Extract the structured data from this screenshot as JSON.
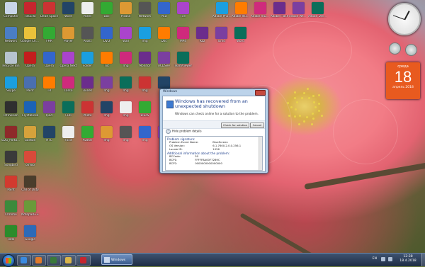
{
  "icons_col1": [
    {
      "label": "Computer",
      "color": "#c9d6e8"
    },
    {
      "label": "Network",
      "color": "#4a7ec4"
    },
    {
      "label": "Recycle Bin",
      "color": "#b7c4cf"
    },
    {
      "label": "Skype",
      "color": "#1a9fe0"
    },
    {
      "label": "InfoVision",
      "color": "#2f2f2f"
    },
    {
      "label": "SDG_Portable",
      "color": "#8e2a2a"
    },
    {
      "label": "Songbird",
      "color": "#3a3a3a"
    },
    {
      "label": "Paint",
      "color": "#d23a2f"
    },
    {
      "label": "Chrome",
      "color": "#3c8a3c"
    },
    {
      "label": "Total",
      "color": "#2b8c2b"
    }
  ],
  "icons_col2": [
    {
      "label": "FileZilla",
      "color": "#c6262e"
    },
    {
      "label": "Google Chrome",
      "color": "#e8c23a"
    },
    {
      "label": "Opera",
      "color": "#c31d1d"
    },
    {
      "label": "Paint",
      "color": "#4a6fb0"
    },
    {
      "label": "CrystalDisk",
      "color": "#1b63b6"
    },
    {
      "label": "Gadwin",
      "color": "#d6a23b"
    },
    {
      "label": "ooVoo",
      "color": "#d84a3a"
    },
    {
      "label": "Call of Duty",
      "color": "#4a3d2c"
    },
    {
      "label": "Notepad++",
      "color": "#6a9a3a"
    },
    {
      "label": "Google",
      "color": "#2d6ab8"
    }
  ],
  "desktop_icons_rows": [
    [
      "Dead Space",
      "Word",
      "Panel",
      "Doc",
      "Picasa",
      "Network",
      "PSD",
      "File",
      "Adobe Photoshop",
      "Adobe Illustrator",
      "Adobe InDesign",
      "Adobe Flash",
      "Adobe After Effects",
      "Adobe Dreamweaver"
    ],
    [
      "FHR",
      "Player",
      "Avast",
      "DVD",
      "Wall",
      "Img",
      "Doc",
      "MP4",
      "Raz",
      "Tcmd",
      "Word"
    ],
    [
      "Opera",
      "Opera Next",
      "Folder",
      "Txt",
      "Img",
      "Monitor",
      "ACDSee",
      "TeamViewer"
    ],
    [
      "TR",
      "Lasso",
      "iTunes",
      "Img",
      "Img",
      "Img",
      "Mk"
    ],
    [
      "Ipad",
      "FHR",
      "Photo",
      "Img",
      "Img",
      "BlueS"
    ],
    [
      "HTC",
      "Foxit",
      "Avatar",
      "Img",
      "Img",
      "Img",
      "Img"
    ]
  ],
  "gadgets": {
    "calendar": {
      "weekday": "среда",
      "day": "18",
      "month_year": "апрель 2018"
    }
  },
  "dialog": {
    "title": "Windows",
    "heading": "Windows has recovered from an unexpected shutdown",
    "subtext": "Windows can check online for a solution to the problem.",
    "check_button": "Check for solution",
    "cancel_button": "Cancel",
    "hide_details": "Hide problem details",
    "details": {
      "section1": "Problem signature:",
      "rows": [
        {
          "k": "Problem Event Name:",
          "v": "BlueScreen"
        },
        {
          "k": "OS Version:",
          "v": "6.1.7600.2.0.0.256.1"
        },
        {
          "k": "Locale ID:",
          "v": "1026"
        }
      ],
      "section2": "Additional information about the problem:",
      "rows2": [
        {
          "k": "BCCode:",
          "v": "50"
        },
        {
          "k": "BCP1:",
          "v": "FFFFF8A00F7289C"
        },
        {
          "k": "BCP2:",
          "v": "0000000000000000"
        }
      ]
    }
  },
  "taskbar": {
    "active_task": "Windows",
    "tray": {
      "lang": "EN",
      "time": "12:38",
      "date": "18.4.2018"
    }
  }
}
